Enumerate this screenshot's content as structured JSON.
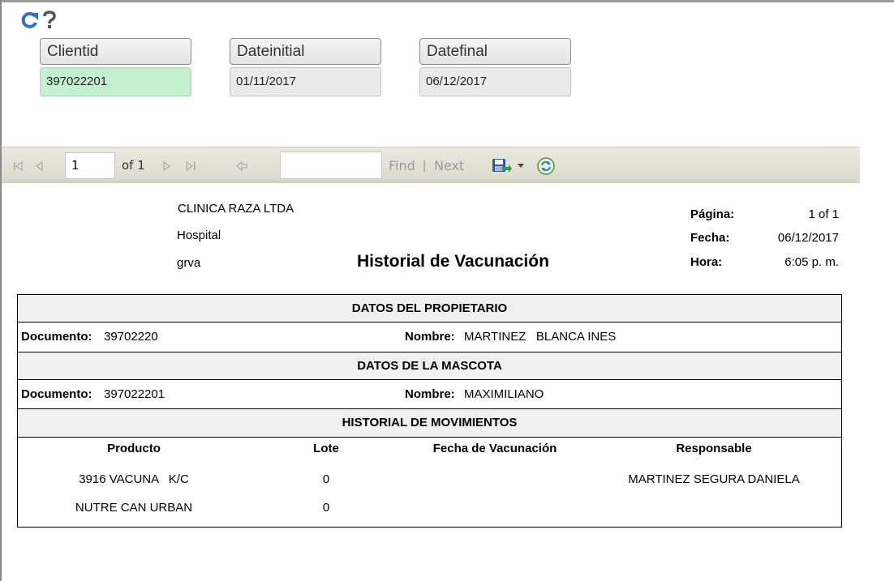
{
  "colors": {
    "accent": "#2e72c4",
    "highlight": "#c5f0d0",
    "toolbar": "#e3e1d6"
  },
  "top_icons": [
    "refresh-icon",
    "help-icon"
  ],
  "parameters": [
    {
      "label": "Clientid",
      "value": "397022201"
    },
    {
      "label": "Dateinitial",
      "value": "01/11/2017"
    },
    {
      "label": "Datefinal",
      "value": "06/12/2017"
    }
  ],
  "toolbar": {
    "page_value": "1",
    "of_text": "of 1",
    "find_label": "Find",
    "separator": "|",
    "next_label": "Next",
    "icons": [
      "first-page-icon",
      "previous-page-icon",
      "next-page-icon",
      "last-page-icon",
      "back-icon",
      "export-icon",
      "dropdown-icon",
      "refresh-report-icon"
    ]
  },
  "report": {
    "company": "CLINICA RAZA LTDA",
    "line2": "Hospital",
    "line3": "grva",
    "title": "Historial de Vacunación",
    "meta": [
      {
        "label": "Página:",
        "value": "1 of 1"
      },
      {
        "label": "Fecha:",
        "value": "06/12/2017"
      },
      {
        "label": "Hora:",
        "value": "6:05 p. m."
      }
    ],
    "owner_section": "DATOS DEL PROPIETARIO",
    "owner": {
      "doc_label": "Documento:",
      "doc_value": "39702220",
      "name_label": "Nombre:",
      "name_value": "MARTINEZ   BLANCA INES"
    },
    "pet_section": "DATOS DE LA MASCOTA",
    "pet": {
      "doc_label": "Documento:",
      "doc_value": "397022201",
      "name_label": "Nombre:",
      "name_value": "MAXIMILIANO"
    },
    "history_section": "HISTORIAL DE MOVIMIENTOS",
    "columns": [
      "Producto",
      "Lote",
      "Fecha de Vacunación",
      "Responsable"
    ],
    "rows": [
      [
        "3916 VACUNA   K/C",
        "0",
        "",
        "MARTINEZ SEGURA DANIELA"
      ],
      [
        "NUTRE CAN URBAN",
        "0",
        "",
        ""
      ]
    ]
  }
}
